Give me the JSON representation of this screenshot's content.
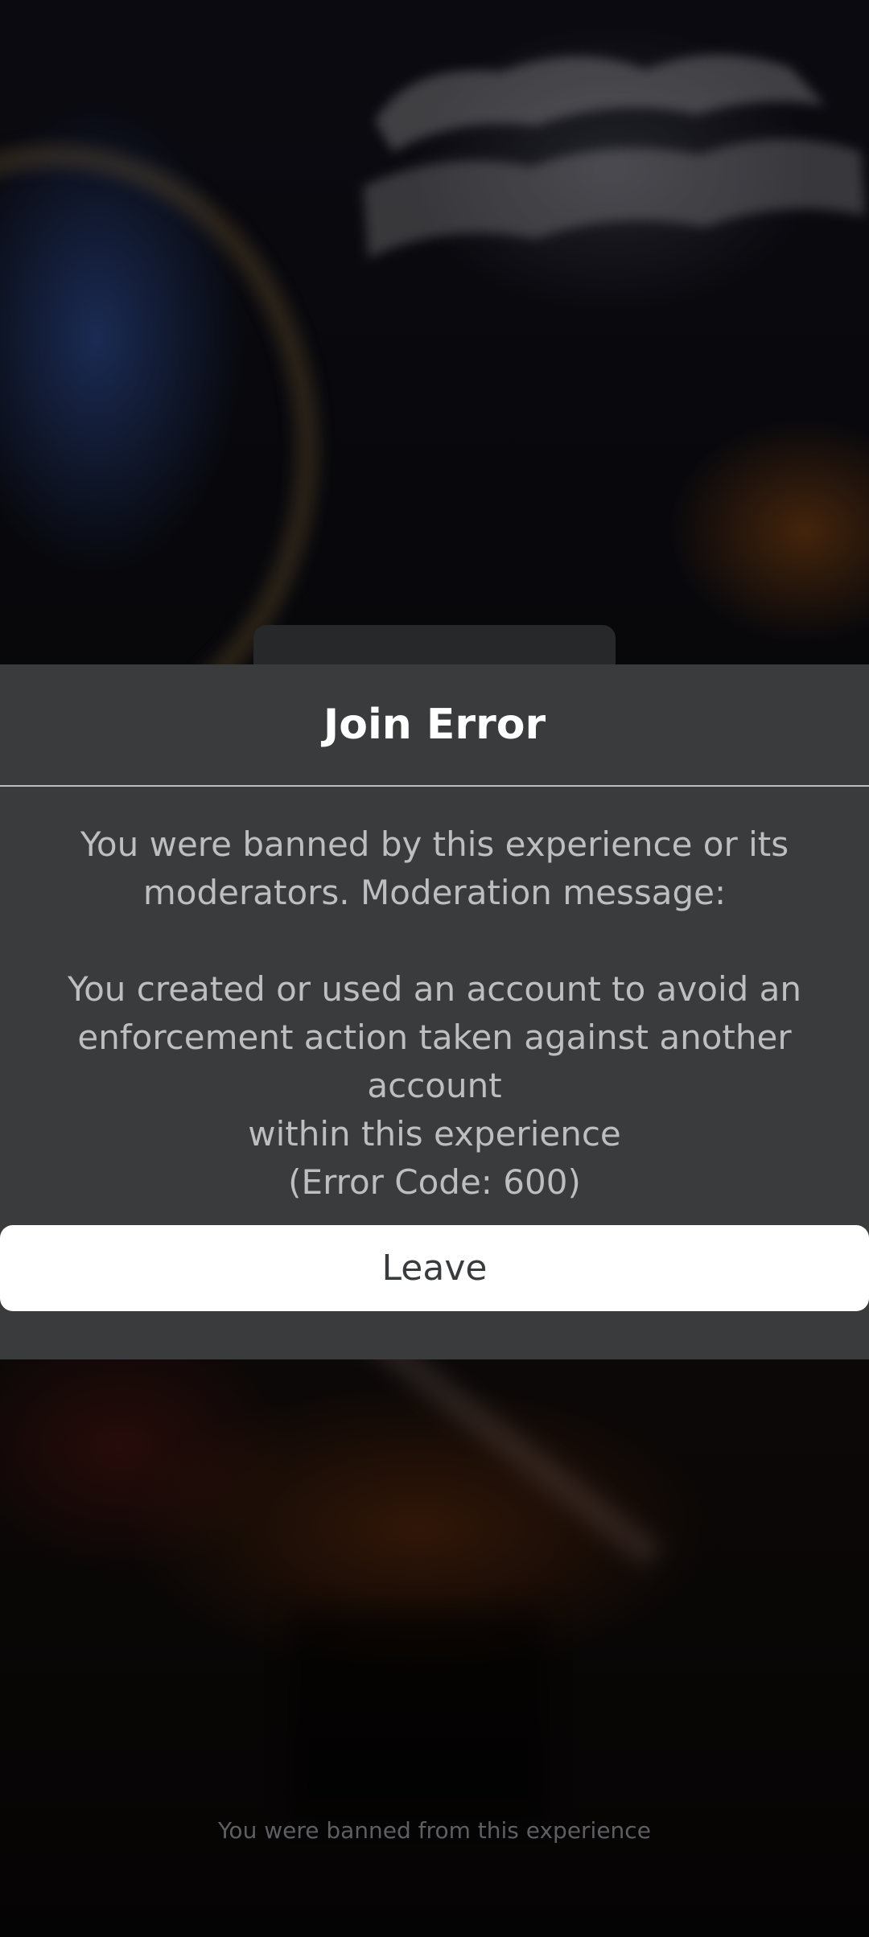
{
  "dialog": {
    "title": "Join Error",
    "message_line_1": "You were banned by this experience or its",
    "message_line_2": "moderators. Moderation message:",
    "reason_line_1": "You created or used an account to avoid an",
    "reason_line_2": "enforcement action taken against another account",
    "reason_line_3": "within this experience",
    "error_code": "(Error Code: 600)",
    "leave_label": "Leave"
  },
  "footer": {
    "status_text": "You were banned from this experience"
  },
  "colors": {
    "dialog_bg": "#393b3d",
    "title": "#ffffff",
    "body_text": "#bdbebe",
    "button_bg": "#ffffff",
    "button_text": "#393b3d"
  }
}
